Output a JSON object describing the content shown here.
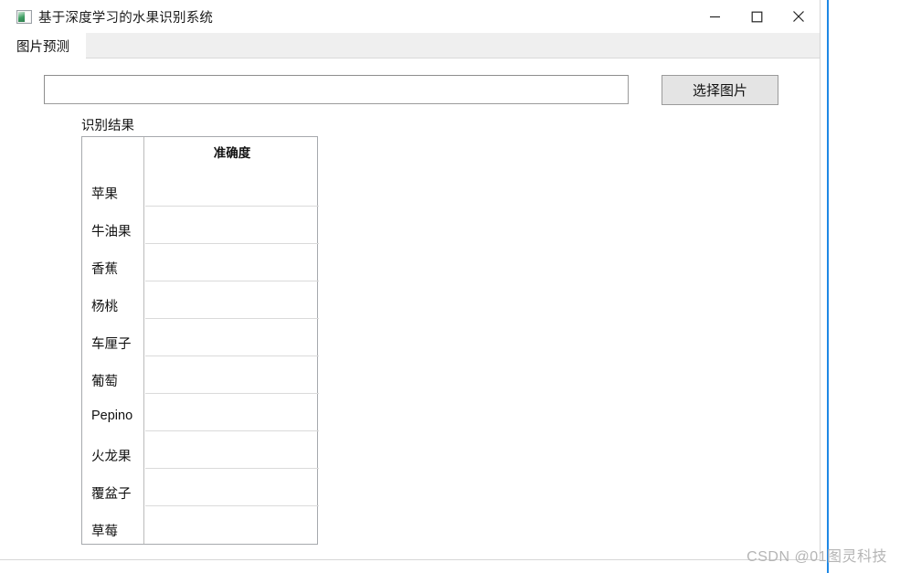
{
  "window": {
    "title": "基于深度学习的水果识别系统",
    "icon": "picture-icon",
    "controls": {
      "minimize": "minimize-icon",
      "maximize": "maximize-icon",
      "close": "close-icon"
    }
  },
  "tabs": [
    {
      "label": "图片预测",
      "selected": true
    }
  ],
  "toolbar": {
    "path_value": "",
    "path_placeholder": "",
    "choose_button_label": "选择图片"
  },
  "result": {
    "section_label": "识别结果",
    "column_header": "准确度",
    "rows": [
      {
        "name": "苹果",
        "accuracy": ""
      },
      {
        "name": "牛油果",
        "accuracy": ""
      },
      {
        "name": "香蕉",
        "accuracy": ""
      },
      {
        "name": "杨桃",
        "accuracy": ""
      },
      {
        "name": "车厘子",
        "accuracy": ""
      },
      {
        "name": "葡萄",
        "accuracy": ""
      },
      {
        "name": "Pepino",
        "accuracy": ""
      },
      {
        "name": "火龙果",
        "accuracy": ""
      },
      {
        "name": "覆盆子",
        "accuracy": ""
      },
      {
        "name": "草莓",
        "accuracy": ""
      }
    ]
  },
  "watermark": {
    "text": "CSDN @01图灵科技"
  },
  "colors": {
    "accent_line": "#1f88e5",
    "tabstrip_bg": "#efefef",
    "button_bg": "#e4e4e4",
    "border": "#9a9a9a",
    "watermark": "#b5b5b5"
  }
}
